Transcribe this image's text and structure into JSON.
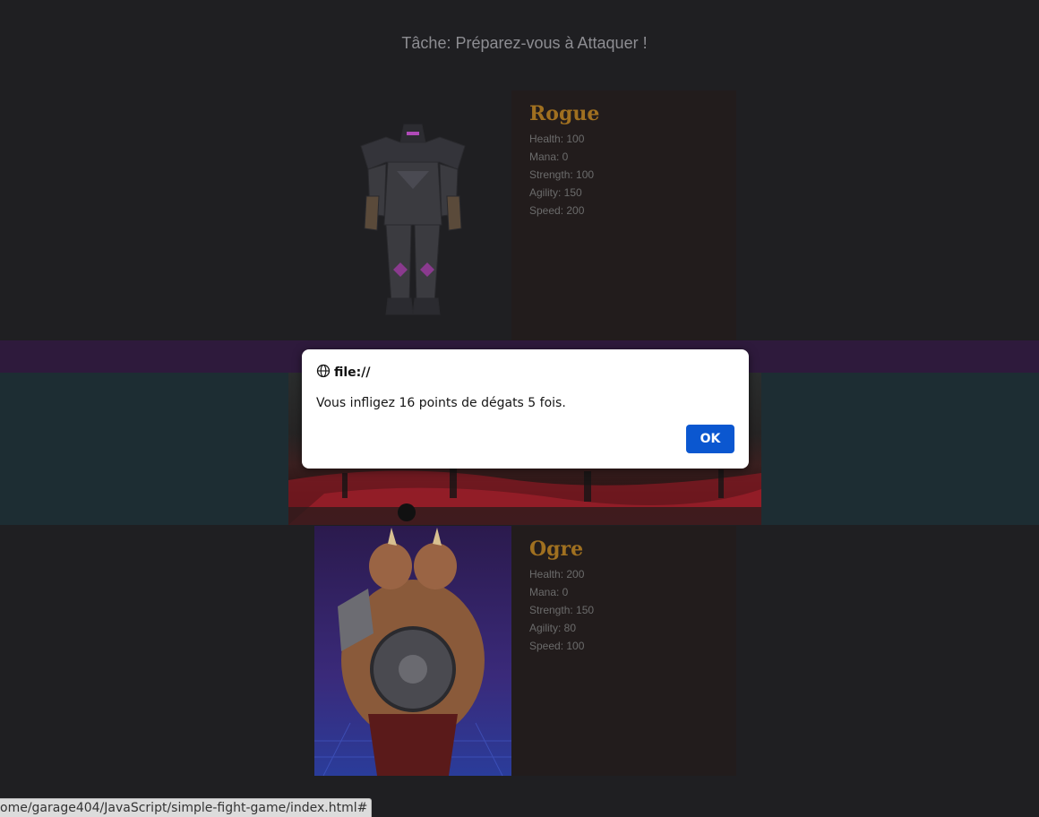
{
  "task": {
    "text": "Tâche: Préparez-vous à Attaquer !"
  },
  "rogue": {
    "name": "Rogue",
    "stats": [
      "Health: 100",
      "Mana: 0",
      "Strength: 100",
      "Agility: 150",
      "Speed: 200"
    ]
  },
  "ogre": {
    "name": "Ogre",
    "stats": [
      "Health: 200",
      "Mana: 0",
      "Strength: 150",
      "Agility: 80",
      "Speed: 100"
    ]
  },
  "dialog": {
    "origin": "file://",
    "message": "Vous infligez 16 points de dégats 5 fois.",
    "ok_label": "OK"
  },
  "status": {
    "url": "ome/garage404/JavaScript/simple-fight-game/index.html#"
  },
  "colors": {
    "name_gold": "#a07020",
    "band_purple": "#2e1a3c",
    "band_teal": "#1d2d33",
    "ok_blue": "#0b57d0"
  },
  "icons": {
    "dialog_origin": "globe-icon"
  }
}
